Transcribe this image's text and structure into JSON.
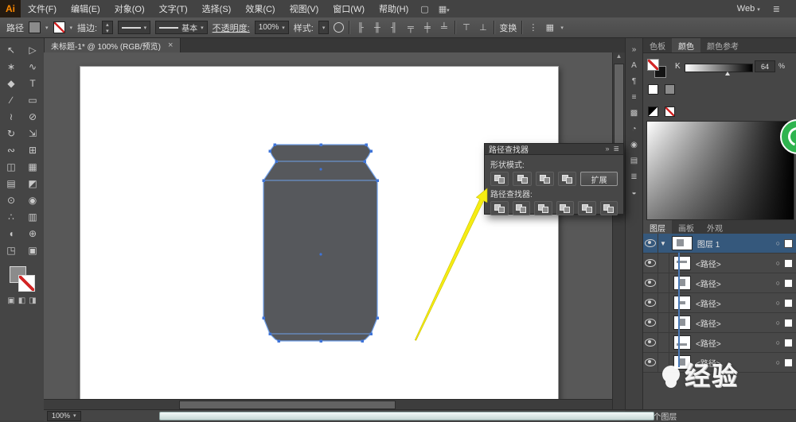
{
  "app": {
    "logo": "Ai",
    "web_label": "Web"
  },
  "menubar": {
    "items": [
      "文件(F)",
      "编辑(E)",
      "对象(O)",
      "文字(T)",
      "选择(S)",
      "效果(C)",
      "视图(V)",
      "窗口(W)",
      "帮助(H)"
    ]
  },
  "controlbar": {
    "title": "路径",
    "stroke_label": "描边:",
    "brush_name": "基本",
    "opacity_label": "不透明度:",
    "opacity_value": "100%",
    "style_label": "样式:",
    "transform_label": "变换"
  },
  "tabbar": {
    "doc_title": "未标题-1* @ 100% (RGB/预览)",
    "close": "×"
  },
  "tools": {
    "glyphs": [
      "↖",
      "▷",
      "∗",
      "∿",
      "◆",
      "T",
      "∕",
      "▭",
      "≀",
      "⊘",
      "↻",
      "⇲",
      "∾",
      "⊞",
      "◫",
      "▦",
      "▤",
      "◩",
      "⊙",
      "◉",
      "∴",
      "▥",
      "◖",
      "⊕",
      "◳",
      "▣"
    ],
    "extras": [
      "▣",
      "◧",
      "◨"
    ]
  },
  "dock": {
    "icons": [
      "»",
      "A",
      "¶",
      "≡",
      "▩",
      "◔",
      "◉",
      "▤",
      "≣",
      "◒"
    ]
  },
  "pathfinder": {
    "title": "路径查找器",
    "shape_modes_label": "形状模式:",
    "expand_label": "扩展",
    "pathfinder_label": "路径查找器:"
  },
  "color_panel": {
    "tabs": [
      "色板",
      "颜色",
      "颜色参考"
    ],
    "channel": "K",
    "value": "64",
    "unit": "%"
  },
  "layers_panel": {
    "tabs": [
      "图层",
      "画板",
      "外观"
    ],
    "rows": [
      {
        "label": "图层 1"
      },
      {
        "label": "<路径>"
      },
      {
        "label": "<路径>"
      },
      {
        "label": "<路径>"
      },
      {
        "label": "<路径>"
      },
      {
        "label": "<路径>"
      },
      {
        "label": "<路径>"
      }
    ],
    "status": "1 个图层"
  },
  "statusbar": {
    "zoom": "100%"
  },
  "watermark": {
    "text": "经验"
  }
}
